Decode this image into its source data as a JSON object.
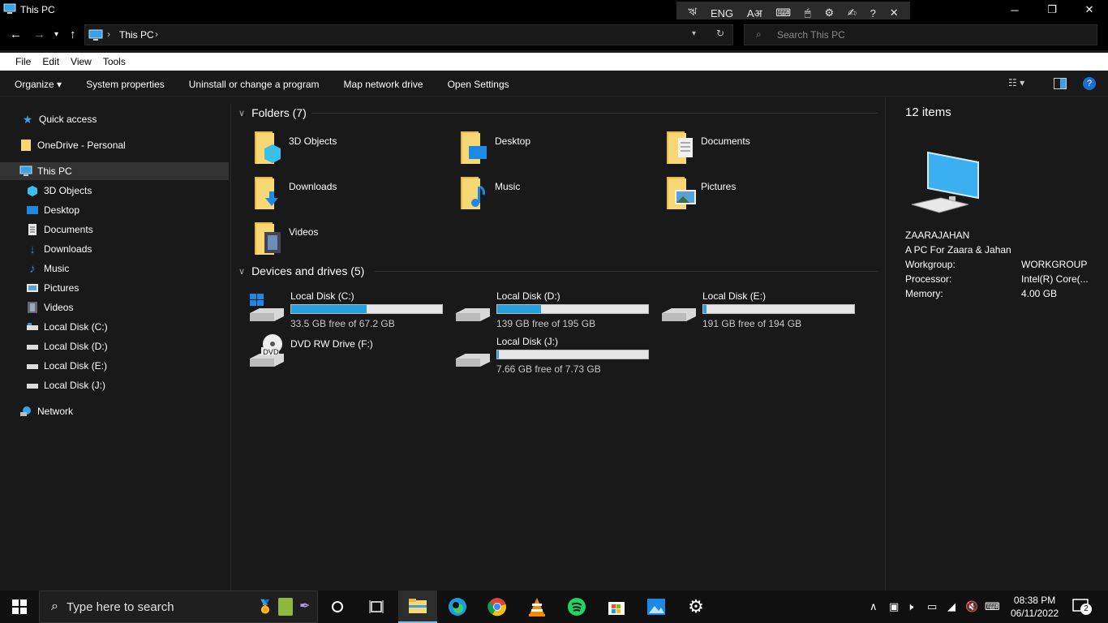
{
  "window": {
    "title": "This PC",
    "controls": {
      "minimize": "─",
      "restore": "❐",
      "close": "✕"
    }
  },
  "langbar": {
    "ime": "ঋ",
    "lang": "ENG"
  },
  "address": {
    "crumb": "This PC",
    "search_placeholder": "Search This PC"
  },
  "menu": {
    "file": "File",
    "edit": "Edit",
    "view": "View",
    "tools": "Tools"
  },
  "commands": {
    "organize": "Organize",
    "system_properties": "System properties",
    "uninstall": "Uninstall or change a program",
    "map_drive": "Map network drive",
    "open_settings": "Open Settings"
  },
  "nav": {
    "quick_access": "Quick access",
    "onedrive": "OneDrive - Personal",
    "this_pc": "This PC",
    "items": [
      "3D Objects",
      "Desktop",
      "Documents",
      "Downloads",
      "Music",
      "Pictures",
      "Videos",
      "Local Disk (C:)",
      "Local Disk (D:)",
      "Local Disk (E:)",
      "Local Disk (J:)"
    ],
    "network": "Network"
  },
  "folders": {
    "header": "Folders (7)",
    "items": [
      "3D Objects",
      "Desktop",
      "Documents",
      "Downloads",
      "Music",
      "Pictures",
      "Videos"
    ]
  },
  "drives": {
    "header": "Devices and drives (5)",
    "items": [
      {
        "name": "Local Disk (C:)",
        "free": "33.5 GB free of 67.2 GB",
        "used_fraction": 0.5
      },
      {
        "name": "Local Disk (D:)",
        "free": "139 GB free of 195 GB",
        "used_fraction": 0.29
      },
      {
        "name": "Local Disk (E:)",
        "free": "191 GB free of 194 GB",
        "used_fraction": 0.02
      },
      {
        "name": "DVD RW Drive (F:)"
      },
      {
        "name": "Local Disk (J:)",
        "free": "7.66 GB free of 7.73 GB",
        "used_fraction": 0.01
      }
    ]
  },
  "details": {
    "count": "12 items",
    "name": "ZAARAJAHAN",
    "description": "A PC For Zaara & Jahan",
    "workgroup_label": "Workgroup:",
    "workgroup_value": "WORKGROUP",
    "processor_label": "Processor:",
    "processor_value": "Intel(R) Core(...",
    "memory_label": "Memory:",
    "memory_value": "4.00 GB"
  },
  "taskbar": {
    "search_placeholder": "Type here to search",
    "time": "08:38 PM",
    "date": "06/11/2022",
    "notifications": "2"
  },
  "colors": {
    "accent": "#26a0da",
    "folder": "#f8d775"
  }
}
